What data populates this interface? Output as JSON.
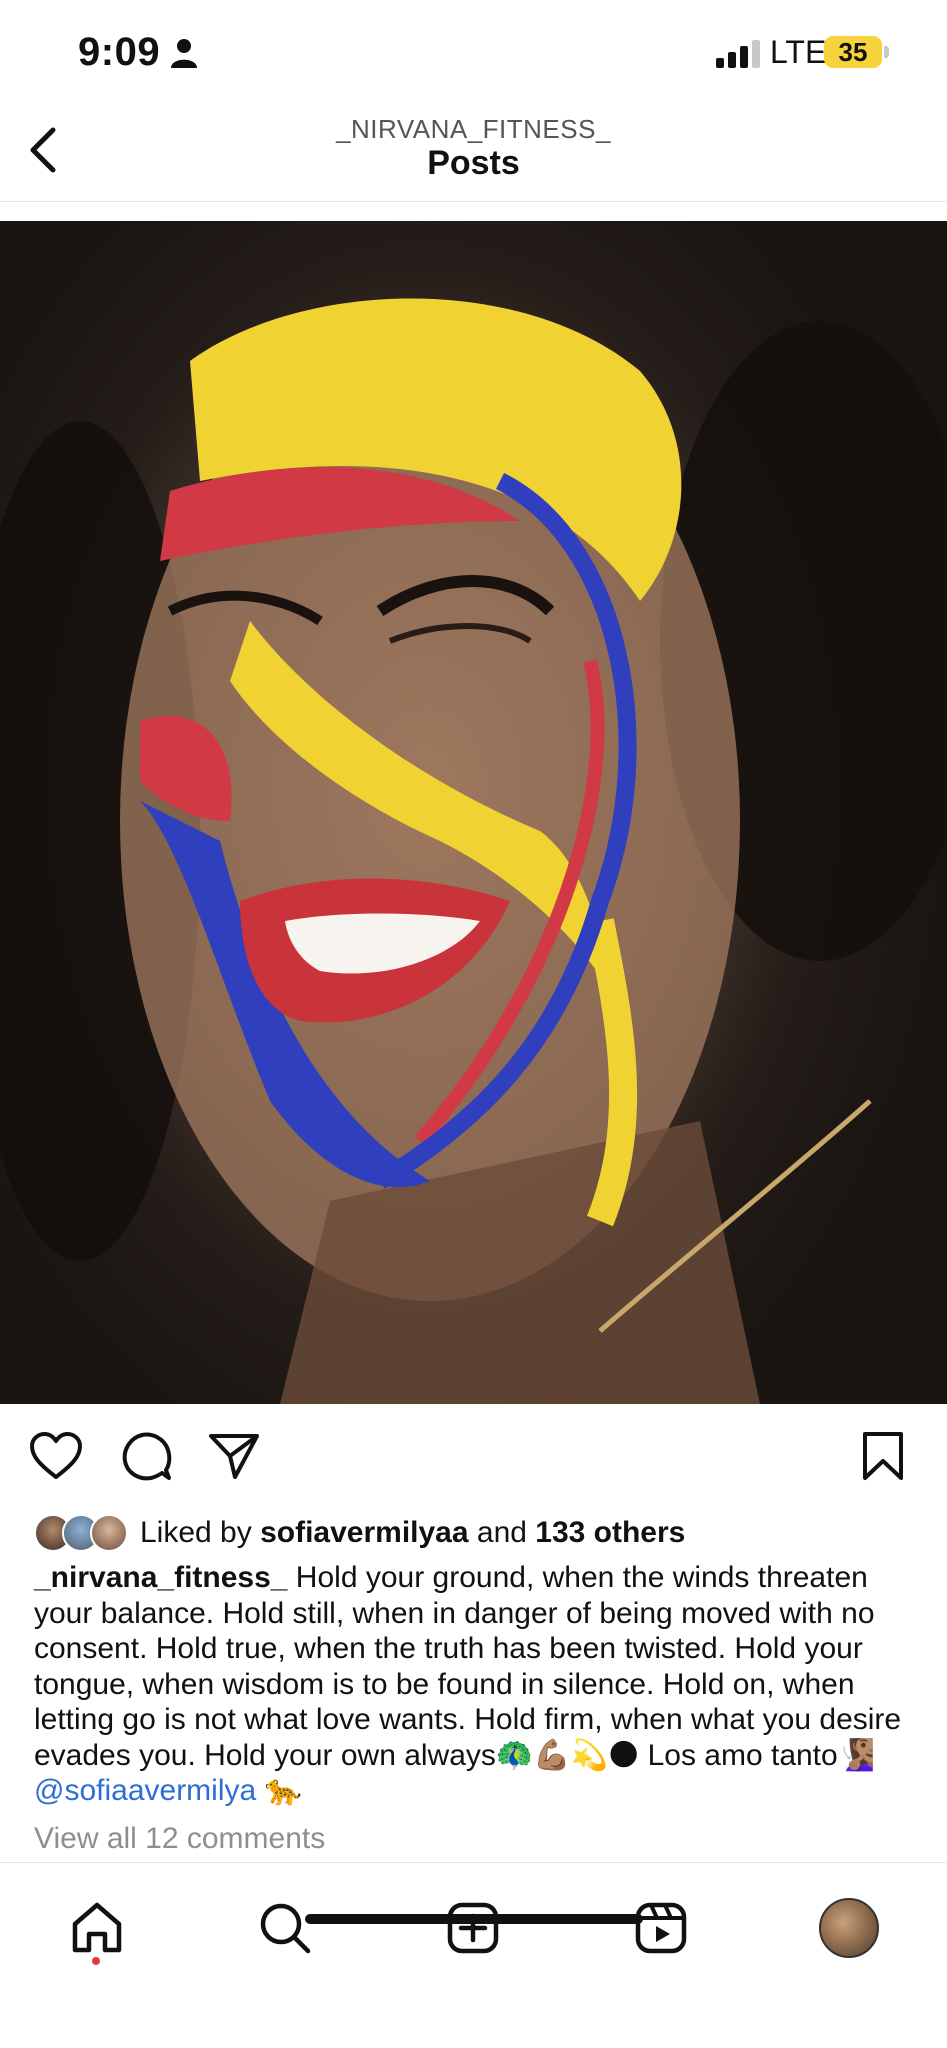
{
  "status_bar": {
    "time": "9:09",
    "carrier": "LTE",
    "battery": "35",
    "icons": [
      "person-icon",
      "signal-icon",
      "battery-icon"
    ]
  },
  "header": {
    "username": "_NIRVANA_FITNESS_",
    "title": "Posts",
    "back_icon": "chevron-left-icon"
  },
  "post": {
    "image_icon": "post-photo",
    "actions": [
      "heart-icon",
      "comment-icon",
      "share-icon",
      "bookmark-icon"
    ],
    "likes": {
      "prefix": "Liked by ",
      "user": "sofiavermilyaa",
      "middle": " and ",
      "others": "133 others"
    },
    "caption": {
      "username": "_nirvana_fitness_",
      "text": " Hold your ground, when the winds threaten your balance. Hold still, when in danger of being moved with no consent. Hold true, when the truth has been twisted. Hold your tongue, when wisdom is to be found in silence. Hold on, when letting go is not what love wants. Hold firm, when what you desire evades you. Hold your own always🦚💪🏽💫🌑 Los amo tanto🧏🏽‍♀️ ",
      "mention": "@sofiaavermilya",
      "tail": " 🐆"
    },
    "comments_link": "View all 12 comments"
  },
  "bottom_nav": {
    "items": [
      "home-icon",
      "search-icon",
      "create-icon",
      "reels-icon",
      "profile-avatar"
    ],
    "accent": "#e8343f"
  },
  "colors": {
    "mention": "#2f6dd6",
    "muted": "#8e8e8e",
    "battery": "#f6d33d"
  }
}
